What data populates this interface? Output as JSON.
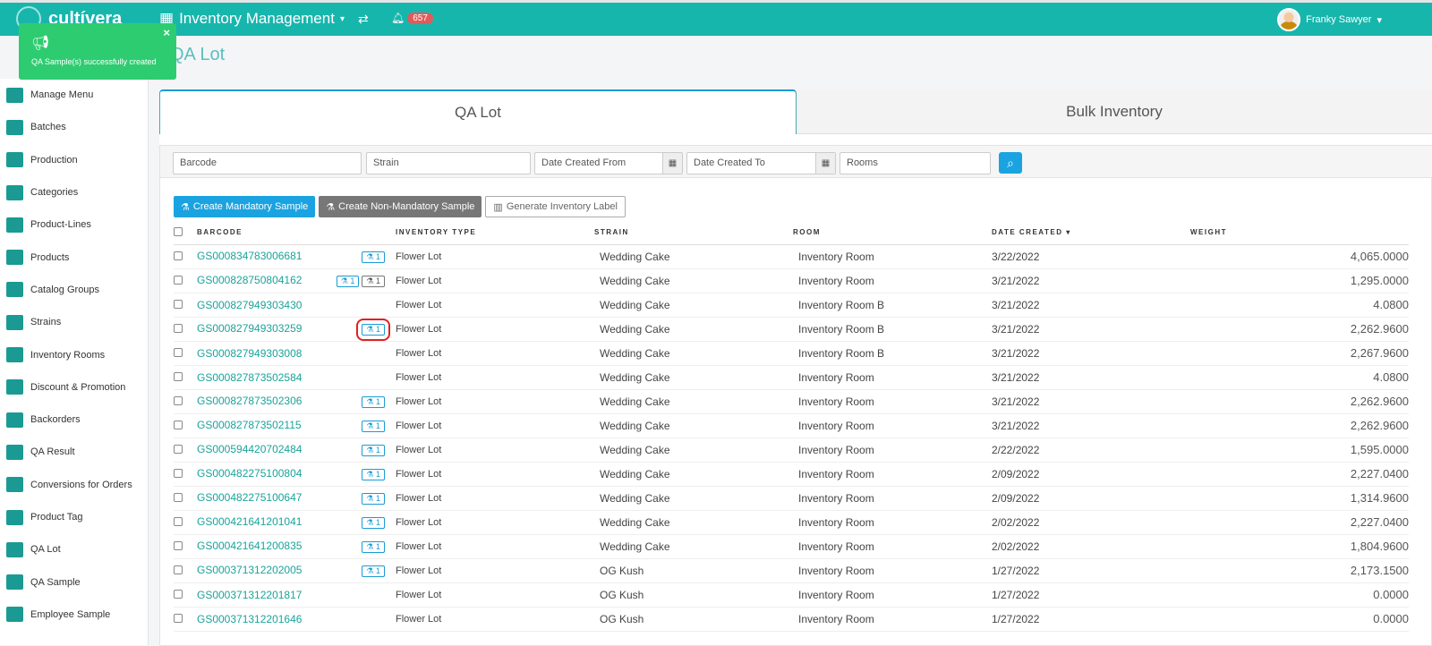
{
  "header": {
    "brand": "cultívera",
    "module": "Inventory Management",
    "notifications": "657",
    "user": "Franky Sawyer"
  },
  "toast": {
    "message": "QA Sample(s) successfully created",
    "close": "×"
  },
  "page_title": "QA Lot",
  "sidebar": [
    "Manage Menu",
    "Batches",
    "Production",
    "Categories",
    "Product-Lines",
    "Products",
    "Catalog Groups",
    "Strains",
    "Inventory Rooms",
    "Discount & Promotion",
    "Backorders",
    "QA Result",
    "Conversions for Orders",
    "Product Tag",
    "QA Lot",
    "QA Sample",
    "Employee Sample"
  ],
  "tabs": [
    "QA Lot",
    "Bulk Inventory"
  ],
  "filters": {
    "barcode": "Barcode",
    "strain": "Strain",
    "from": "Date Created From",
    "to": "Date Created To",
    "rooms": "Rooms"
  },
  "buttons": {
    "mandatory": "Create Mandatory Sample",
    "non_mandatory": "Create Non-Mandatory Sample",
    "label": "Generate Inventory Label"
  },
  "columns": [
    "BARCODE",
    "INVENTORY TYPE",
    "STRAIN",
    "ROOM",
    "DATE CREATED ▾",
    "WEIGHT"
  ],
  "rows": [
    {
      "barcode": "GS000834783006681",
      "qa": "1",
      "nm": null,
      "type": "Flower Lot",
      "strain": "Wedding Cake",
      "room": "Inventory Room",
      "date": "3/22/2022",
      "weight": "4,065.0000"
    },
    {
      "barcode": "GS000828750804162",
      "qa": "1",
      "nm": "1",
      "type": "Flower Lot",
      "strain": "Wedding Cake",
      "room": "Inventory Room",
      "date": "3/21/2022",
      "weight": "1,295.0000"
    },
    {
      "barcode": "GS000827949303430",
      "qa": null,
      "nm": null,
      "type": "Flower Lot",
      "strain": "Wedding Cake",
      "room": "Inventory Room B",
      "date": "3/21/2022",
      "weight": "4.0800"
    },
    {
      "barcode": "GS000827949303259",
      "qa": "1",
      "nm": null,
      "type": "Flower Lot",
      "strain": "Wedding Cake",
      "room": "Inventory Room B",
      "date": "3/21/2022",
      "weight": "2,262.9600",
      "highlight": true
    },
    {
      "barcode": "GS000827949303008",
      "qa": null,
      "nm": null,
      "type": "Flower Lot",
      "strain": "Wedding Cake",
      "room": "Inventory Room B",
      "date": "3/21/2022",
      "weight": "2,267.9600"
    },
    {
      "barcode": "GS000827873502584",
      "qa": null,
      "nm": null,
      "type": "Flower Lot",
      "strain": "Wedding Cake",
      "room": "Inventory Room",
      "date": "3/21/2022",
      "weight": "4.0800"
    },
    {
      "barcode": "GS000827873502306",
      "qa": "1",
      "nm": null,
      "type": "Flower Lot",
      "strain": "Wedding Cake",
      "room": "Inventory Room",
      "date": "3/21/2022",
      "weight": "2,262.9600"
    },
    {
      "barcode": "GS000827873502115",
      "qa": "1",
      "nm": null,
      "type": "Flower Lot",
      "strain": "Wedding Cake",
      "room": "Inventory Room",
      "date": "3/21/2022",
      "weight": "2,262.9600"
    },
    {
      "barcode": "GS000594420702484",
      "qa": "1",
      "nm": null,
      "type": "Flower Lot",
      "strain": "Wedding Cake",
      "room": "Inventory Room",
      "date": "2/22/2022",
      "weight": "1,595.0000"
    },
    {
      "barcode": "GS000482275100804",
      "qa": "1",
      "nm": null,
      "type": "Flower Lot",
      "strain": "Wedding Cake",
      "room": "Inventory Room",
      "date": "2/09/2022",
      "weight": "2,227.0400"
    },
    {
      "barcode": "GS000482275100647",
      "qa": "1",
      "nm": null,
      "type": "Flower Lot",
      "strain": "Wedding Cake",
      "room": "Inventory Room",
      "date": "2/09/2022",
      "weight": "1,314.9600"
    },
    {
      "barcode": "GS000421641201041",
      "qa": "1",
      "nm": null,
      "type": "Flower Lot",
      "strain": "Wedding Cake",
      "room": "Inventory Room",
      "date": "2/02/2022",
      "weight": "2,227.0400"
    },
    {
      "barcode": "GS000421641200835",
      "qa": "1",
      "nm": null,
      "type": "Flower Lot",
      "strain": "Wedding Cake",
      "room": "Inventory Room",
      "date": "2/02/2022",
      "weight": "1,804.9600"
    },
    {
      "barcode": "GS000371312202005",
      "qa": "1",
      "nm": null,
      "type": "Flower Lot",
      "strain": "OG Kush",
      "room": "Inventory Room",
      "date": "1/27/2022",
      "weight": "2,173.1500"
    },
    {
      "barcode": "GS000371312201817",
      "qa": null,
      "nm": null,
      "type": "Flower Lot",
      "strain": "OG Kush",
      "room": "Inventory Room",
      "date": "1/27/2022",
      "weight": "0.0000"
    },
    {
      "barcode": "GS000371312201646",
      "qa": null,
      "nm": null,
      "type": "Flower Lot",
      "strain": "OG Kush",
      "room": "Inventory Room",
      "date": "1/27/2022",
      "weight": "0.0000"
    }
  ]
}
